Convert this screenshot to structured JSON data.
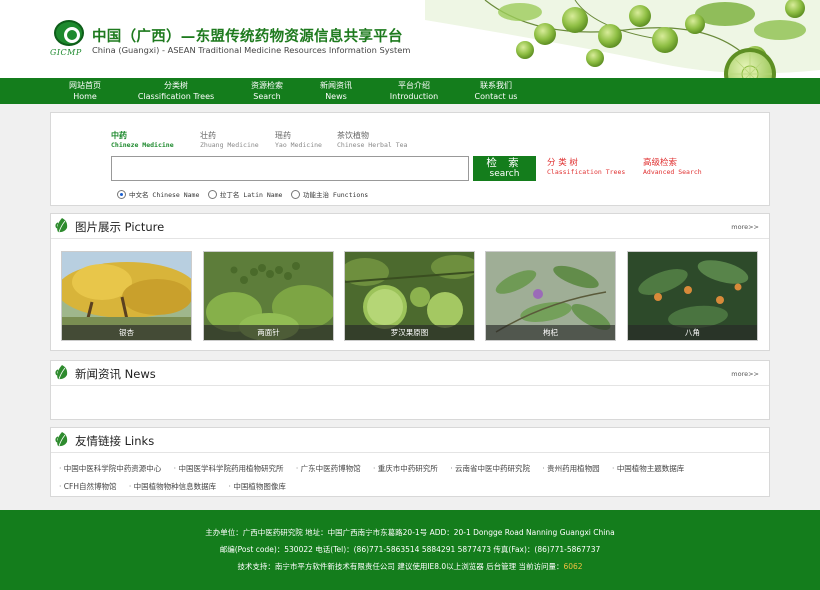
{
  "header": {
    "logo_text": "GICMP",
    "title_cn": "中国（广西）—东盟传统药物资源信息共享平台",
    "title_en": "China (Guangxi) - ASEAN Traditional Medicine Resources Information System"
  },
  "nav": [
    {
      "cn": "网站首页",
      "en": "Home"
    },
    {
      "cn": "分类树",
      "en": "Classification Trees"
    },
    {
      "cn": "资源检索",
      "en": "Search"
    },
    {
      "cn": "新闻资讯",
      "en": "News"
    },
    {
      "cn": "平台介绍",
      "en": "Introduction"
    },
    {
      "cn": "联系我们",
      "en": "Contact us"
    }
  ],
  "search": {
    "tabs": [
      {
        "cn": "中药",
        "en": "Chineze Medicine"
      },
      {
        "cn": "壮药",
        "en": "Zhuang Medicine"
      },
      {
        "cn": "瑶药",
        "en": "Yao Medicine"
      },
      {
        "cn": "茶饮植物",
        "en": "Chinese Herbal Tea"
      }
    ],
    "input_value": "",
    "button_cn": "检 索",
    "button_en": "search",
    "classification_cn": "分 类 树",
    "classification_en": "Classification Trees",
    "advanced_cn": "高级检索",
    "advanced_en": "Advanced Search",
    "radios": [
      {
        "label": "中文名 Chinese Name",
        "checked": true
      },
      {
        "label": "拉丁名 Latin Name",
        "checked": false
      },
      {
        "label": "功能主治 Functions",
        "checked": false
      }
    ]
  },
  "picture": {
    "title": "图片展示 Picture",
    "more": "more>>",
    "items": [
      {
        "caption": "银杏",
        "icon": "ginkgo-photo"
      },
      {
        "caption": "两面针",
        "icon": "zanthoxylum-photo"
      },
      {
        "caption": "罗汉果原图",
        "icon": "monk-fruit-photo"
      },
      {
        "caption": "枸杞",
        "icon": "goji-photo"
      },
      {
        "caption": "八角",
        "icon": "star-anise-photo"
      }
    ]
  },
  "news": {
    "title": "新闻资讯 News",
    "more": "more>>"
  },
  "links": {
    "title": "友情链接 Links",
    "items": [
      "中国中医科学院中药资源中心",
      "中国医学科学院药用植物研究所",
      "广东中医药博物馆",
      "重庆市中药研究所",
      "云南省中医中药研究院",
      "贵州药用植物园",
      "中国植物主题数据库",
      "CFH自然博物馆",
      "中国植物物种信息数据库",
      "中国植物图像库"
    ]
  },
  "footer": {
    "line1": "主办单位：广西中医药研究院  地址：中国广西南宁市东葛路20-1号  ADD：20-1 Dongge Road Nanning Guangxi China",
    "line2": "邮编(Post code)：530022  电话(Tel)：(86)771-5863514  5884291  5877473  传真(Fax)：(86)771-5867737",
    "line3_prefix": "技术支持：南宁市平方软件新技术有限责任公司  建议使用IE8.0以上浏览器  后台管理  当前访问量：",
    "counter": "6062"
  },
  "colors": {
    "brand_green": "#147d1c",
    "link_red": "#e03232"
  }
}
